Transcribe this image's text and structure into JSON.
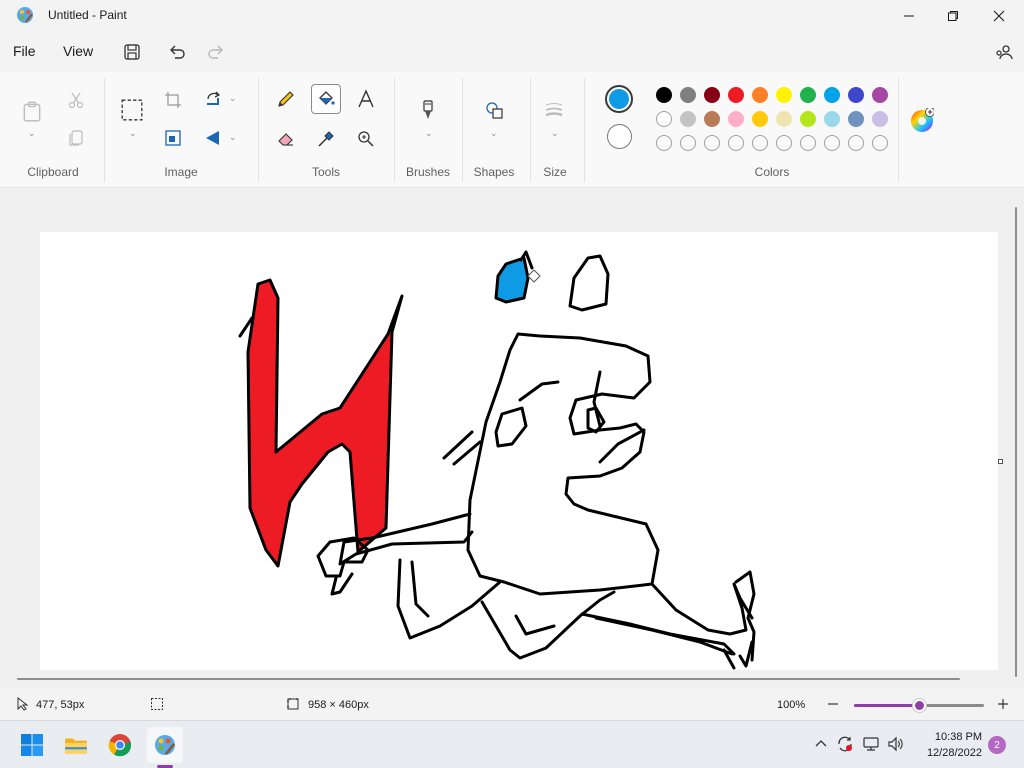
{
  "window": {
    "title": "Untitled - Paint"
  },
  "menu": {
    "file": "File",
    "view": "View"
  },
  "ribbon": {
    "groups": {
      "clipboard": "Clipboard",
      "image": "Image",
      "tools": "Tools",
      "brushes": "Brushes",
      "shapes": "Shapes",
      "size": "Size",
      "colors": "Colors"
    },
    "selected_tool": "fill-bucket",
    "primary_color": "#0f9ae5",
    "secondary_color": "#ffffff",
    "palette_row1": [
      "#000000",
      "#7f7f7f",
      "#880015",
      "#ed1c24",
      "#ff7f27",
      "#fff200",
      "#22b14c",
      "#00a2e8",
      "#3f48cc",
      "#a349a4"
    ],
    "palette_row2": [
      "#ffffff",
      "#c3c3c3",
      "#b97a57",
      "#ffaec9",
      "#ffc90e",
      "#efe4b0",
      "#b5e61d",
      "#99d9ea",
      "#7092be",
      "#c8bfe7"
    ],
    "palette_row3_custom_empty": 10
  },
  "drawing": {
    "fill_red": "#ed1c24",
    "fill_blue": "#0f9ae5",
    "stroke": "#000000"
  },
  "status": {
    "cursor_position": "477, 53px",
    "canvas_size": "958 × 460px",
    "zoom": "100%",
    "zoom_level_percent": 100
  },
  "taskbar": {
    "apps": [
      "start-icon",
      "file-explorer-icon",
      "chrome-icon",
      "paint-icon"
    ],
    "time": "10:38 PM",
    "date": "12/28/2022",
    "notification_count": "2"
  }
}
